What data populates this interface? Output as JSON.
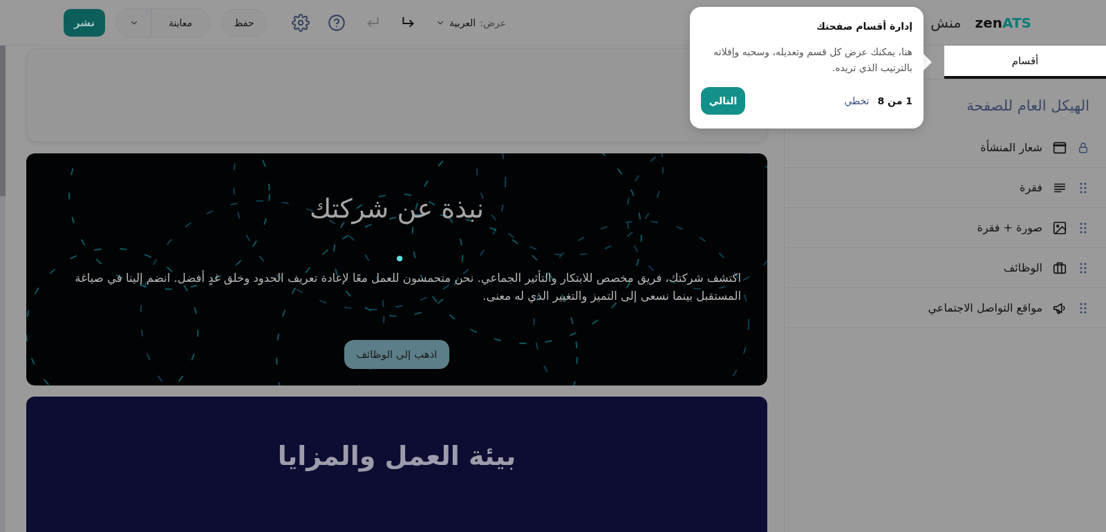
{
  "header": {
    "logo": {
      "primary": "zen",
      "accent": "ATS"
    },
    "title": "منش",
    "view_label": "عرض:",
    "language": "العربية",
    "undo_disabled": true,
    "save": "حفظ",
    "preview": "معاينة",
    "publish": "نشر"
  },
  "sidebar": {
    "tabs": [
      {
        "label": "أقسام",
        "selected": true
      }
    ],
    "heading": "الهيكل العام للصفحة",
    "sections": [
      {
        "label": "شعار المنشأة",
        "kind": "header",
        "locked": true
      },
      {
        "label": "فقرة",
        "kind": "paragraph",
        "locked": false
      },
      {
        "label": "صورة + فقرة",
        "kind": "image_paragraph",
        "locked": false
      },
      {
        "label": "الوظائف",
        "kind": "jobs",
        "locked": false
      },
      {
        "label": "مواقع التواصل الاجتماعي",
        "kind": "social",
        "locked": false
      }
    ]
  },
  "tour": {
    "title": "إدارة أقسام صفحتك",
    "body": "هنا، يمكنك عرض كل قسم وتعديله، وسحبه وإفلاته بالترتيب الذي تريده.",
    "progress": "1 من 8",
    "skip": "تخطي",
    "next": "التالي"
  },
  "canvas": {
    "sections": [
      {
        "kind": "blank"
      },
      {
        "kind": "hero",
        "title": "نبذة عن شركتك",
        "body": "اكتشف شركتك، فريق مخصص للابتكار والتأثير الجماعي. نحن متحمسون للعمل معًا لإعادة تعريف الحدود وخلق غدٍ أفضل. انضم إلينا في صياغة المستقبل بينما نسعى إلى التميز والتغيير الذي له معنى.",
        "button": "اذهب إلى الوظائف"
      },
      {
        "kind": "banner",
        "title": "بيئة العمل والمزايا"
      }
    ]
  }
}
